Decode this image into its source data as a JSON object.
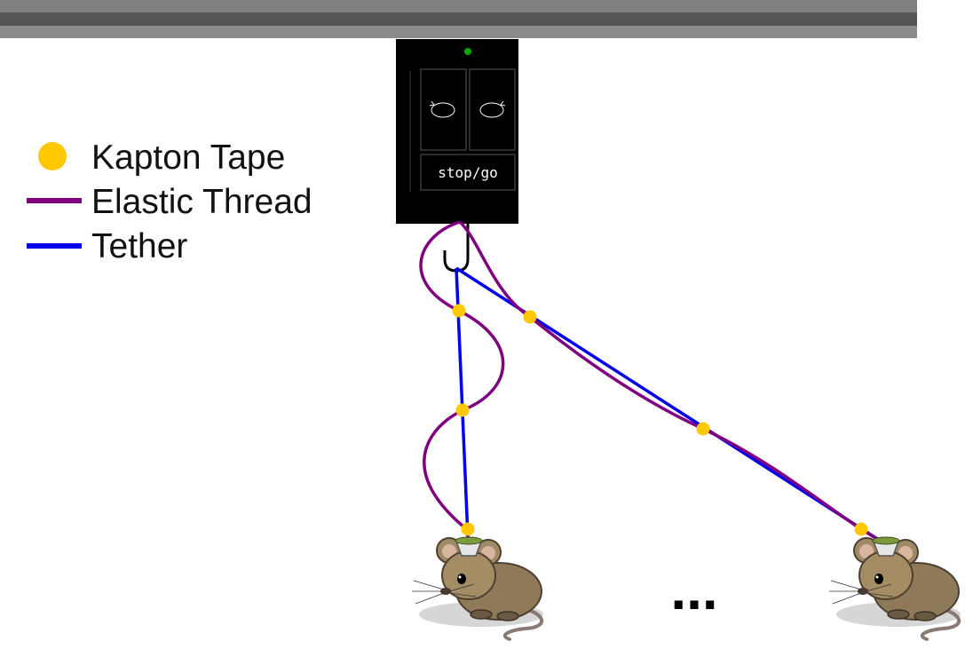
{
  "legend": {
    "items": [
      {
        "label": "Kapton Tape",
        "kind": "dot",
        "color": "#ffc800"
      },
      {
        "label": "Elastic Thread",
        "kind": "line",
        "color": "#800080"
      },
      {
        "label": "Tether",
        "kind": "line",
        "color": "#0000ee"
      }
    ]
  },
  "device": {
    "button_label": "stop/go",
    "left_button_icon": "rotate-counterclockwise-icon",
    "right_button_icon": "rotate-clockwise-icon",
    "indicator_color": "#00aa00",
    "body_color": "#000000"
  },
  "ellipsis": "...",
  "colors": {
    "rail": "#808080",
    "rail_dark": "#555555",
    "tape": "#ffc800",
    "elastic": "#800080",
    "tether": "#0000ee"
  }
}
